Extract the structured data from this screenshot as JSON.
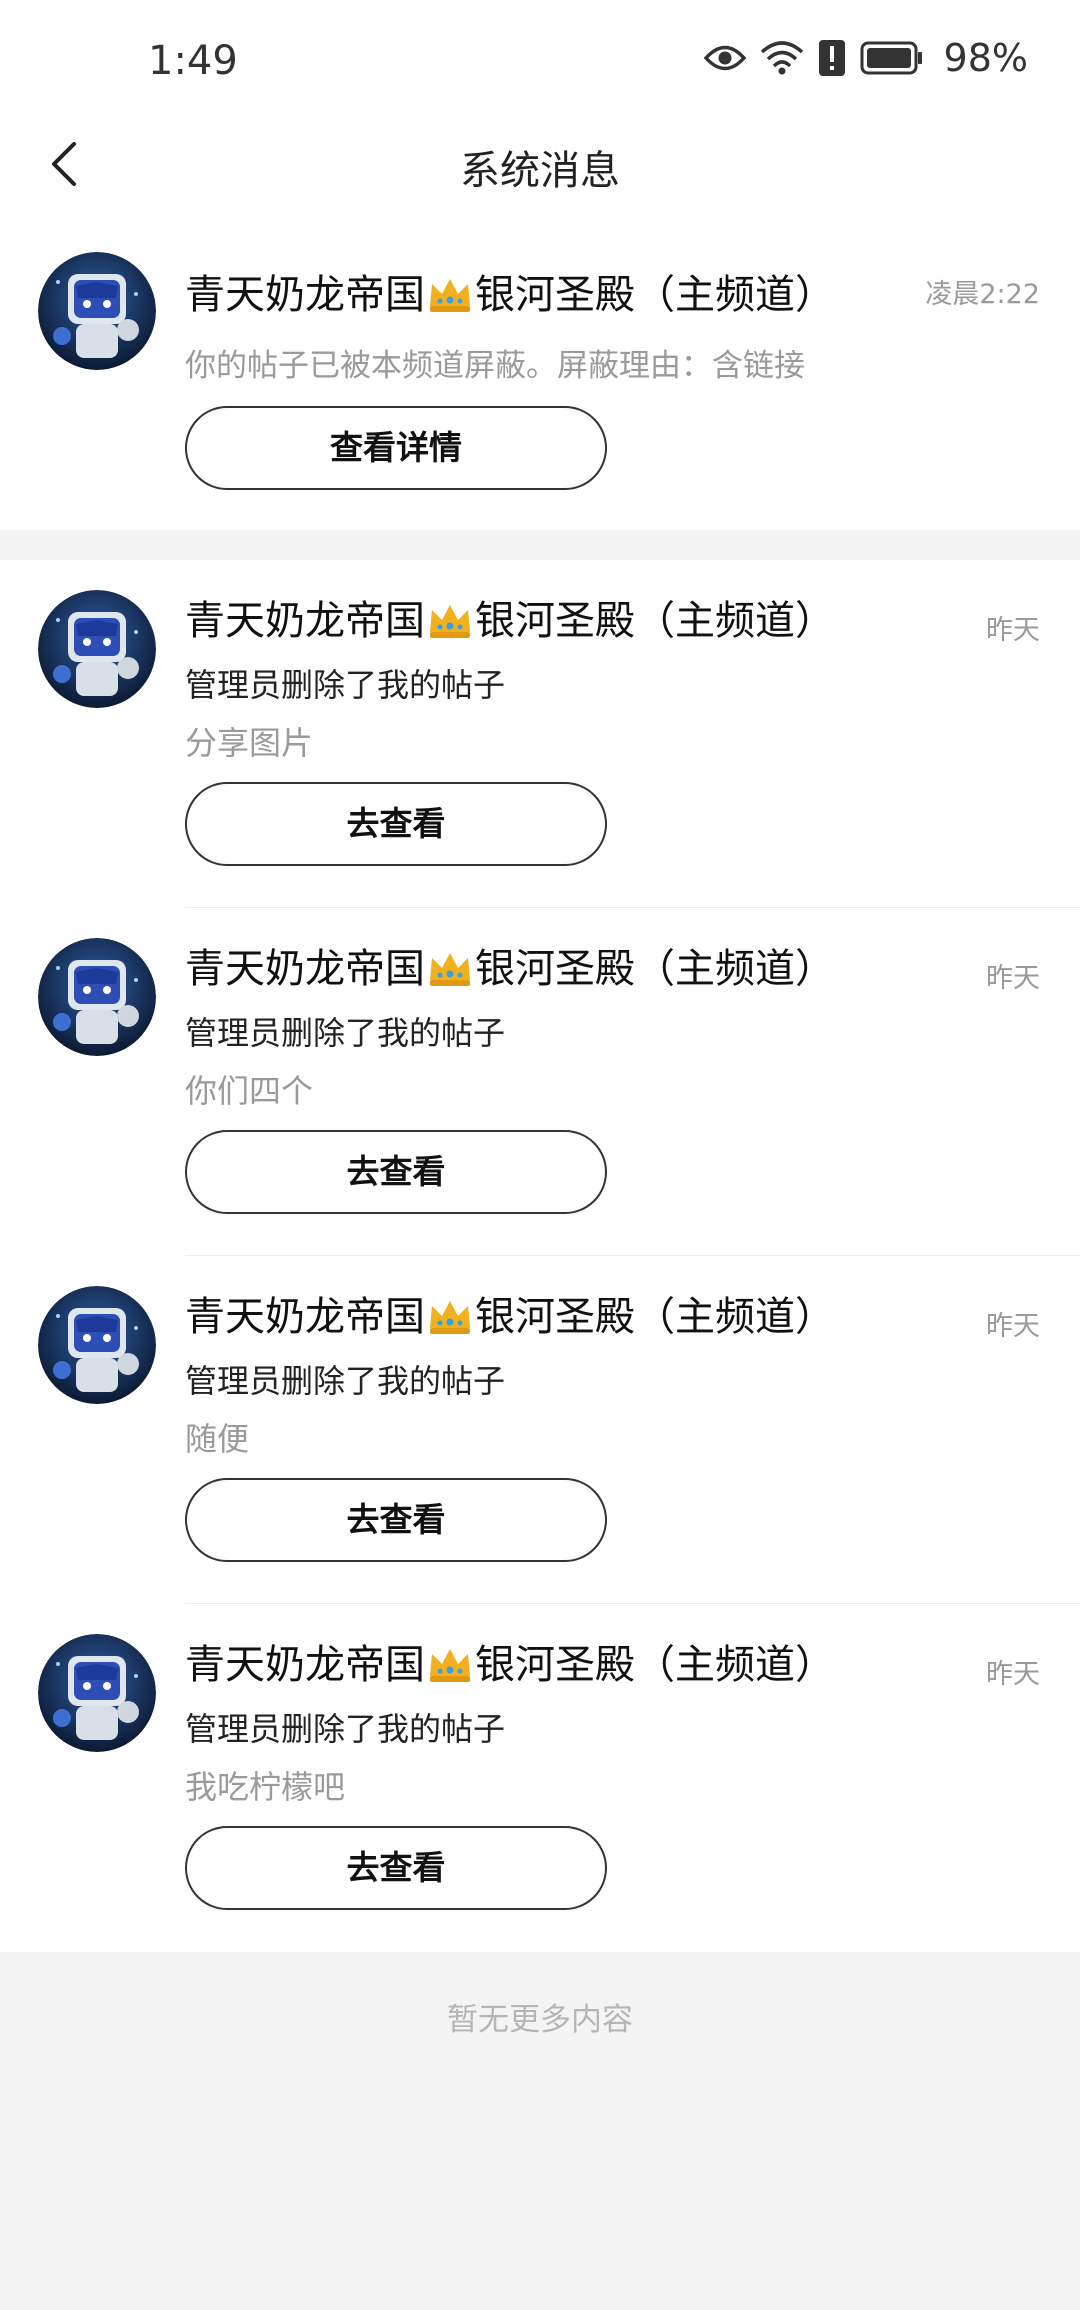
{
  "status_bar": {
    "time": "1:49",
    "battery": "98%",
    "icons": [
      "eye-icon",
      "wifi-icon",
      "alert-icon",
      "battery-icon"
    ]
  },
  "header": {
    "title": "系统消息",
    "back_icon": "chevron-left-icon"
  },
  "messages": [
    {
      "title_pre": "青天奶龙帝国",
      "title_post": "银河圣殿（主频道）",
      "time": "凌晨2:22",
      "line1": "你的帖子已被本频道屏蔽。屏蔽理由：含链接",
      "button": "查看详情"
    },
    {
      "title_pre": "青天奶龙帝国",
      "title_post": "银河圣殿（主频道）",
      "time": "昨天",
      "line1": "管理员删除了我的帖子",
      "line2": "分享图片",
      "button": "去查看"
    },
    {
      "title_pre": "青天奶龙帝国",
      "title_post": "银河圣殿（主频道）",
      "time": "昨天",
      "line1": "管理员删除了我的帖子",
      "line2": "你们四个",
      "button": "去查看"
    },
    {
      "title_pre": "青天奶龙帝国",
      "title_post": "银河圣殿（主频道）",
      "time": "昨天",
      "line1": "管理员删除了我的帖子",
      "line2": "随便",
      "button": "去查看"
    },
    {
      "title_pre": "青天奶龙帝国",
      "title_post": "银河圣殿（主频道）",
      "time": "昨天",
      "line1": "管理员删除了我的帖子",
      "line2": "我吃柠檬吧",
      "button": "去查看"
    }
  ],
  "footer": "暂无更多内容",
  "colors": {
    "background": "#f4f4f4",
    "card": "#ffffff",
    "grey_text": "#9a9a9a",
    "crown": "#f2b01e"
  }
}
